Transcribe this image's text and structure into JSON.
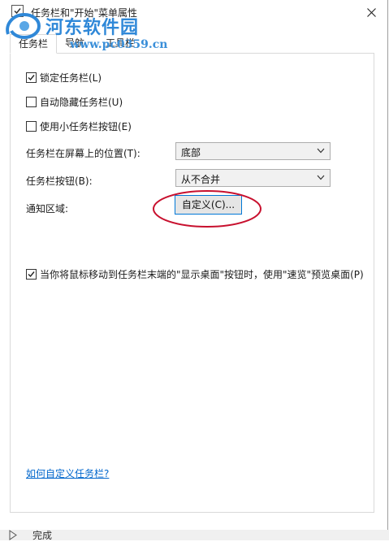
{
  "window": {
    "title": "任务栏和\"开始\"菜单属性"
  },
  "watermark": {
    "title": "河东软件园",
    "url": "www.pc0359.cn"
  },
  "tabs": [
    {
      "label": "任务栏",
      "active": true
    },
    {
      "label": "导航",
      "active": false
    },
    {
      "label": "工具栏",
      "active": false
    }
  ],
  "checkboxes": {
    "lock": {
      "label": "锁定任务栏(L)",
      "checked": true
    },
    "autohide": {
      "label": "自动隐藏任务栏(U)",
      "checked": false
    },
    "small_buttons": {
      "label": "使用小任务栏按钮(E)",
      "checked": false
    },
    "peek": {
      "label": "当你将鼠标移动到任务栏末端的\"显示桌面\"按钮时，使用\"速览\"预览桌面(P)",
      "checked": true
    }
  },
  "position": {
    "label": "任务栏在屏幕上的位置(T):",
    "value": "底部"
  },
  "buttons_combine": {
    "label": "任务栏按钮(B):",
    "value": "从不合并"
  },
  "notification": {
    "label": "通知区域:",
    "button_label": "自定义(C)..."
  },
  "help_link": "如何自定义任务栏?",
  "bottom_strip": {
    "text": "完成"
  },
  "colors": {
    "accent": "#0078d7",
    "annotation": "#c8102e",
    "link": "#0066cc"
  }
}
